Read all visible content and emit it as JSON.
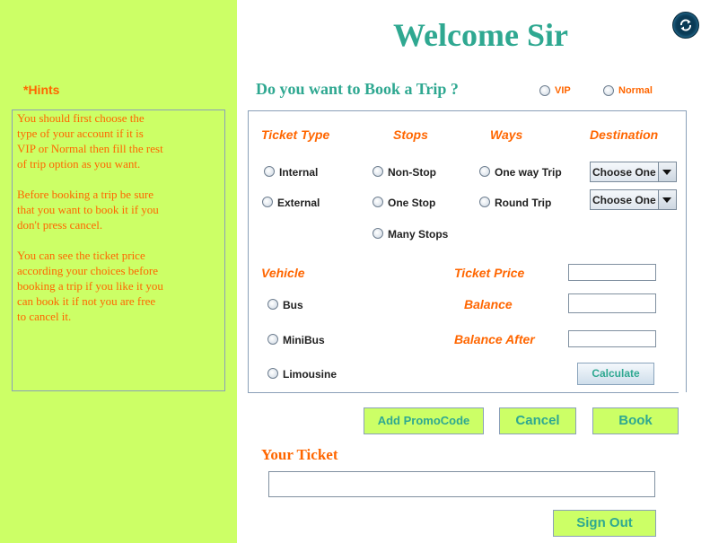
{
  "hints": {
    "title": "*Hints",
    "paragraphs": [
      "You should first choose the\ntype of your account if it is\nVIP or Normal then fill the rest\nof trip option as you want.",
      "Before booking a trip be sure\nthat you want to book it if you\ndon't press cancel.",
      "You can see the ticket price\naccording your choices before\nbooking a trip if you like it you\ncan book it if not you are free\nto cancel it."
    ]
  },
  "header": {
    "welcome": "Welcome Sir",
    "refresh_icon": "refresh-icon"
  },
  "account": {
    "question": "Do you want to Book a Trip ?",
    "vip_label": "VIP",
    "normal_label": "Normal"
  },
  "trip": {
    "ticket_type_header": "Ticket Type",
    "ticket_types": [
      "Internal",
      "External"
    ],
    "stops_header": "Stops",
    "stops": [
      "Non-Stop",
      "One Stop",
      "Many Stops"
    ],
    "ways_header": "Ways",
    "ways": [
      "One way Trip",
      "Round Trip"
    ],
    "destination_header": "Destination",
    "destination_from": "Choose One",
    "destination_to": "Choose One",
    "vehicle_header": "Vehicle",
    "vehicles": [
      "Bus",
      "MiniBus",
      "Limousine"
    ],
    "ticket_price_label": "Ticket Price",
    "ticket_price_value": "",
    "balance_label": "Balance",
    "balance_value": "",
    "balance_after_label": "Balance After",
    "balance_after_value": "",
    "calculate_label": "Calculate"
  },
  "actions": {
    "promo_label": "Add PromoCode",
    "cancel_label": "Cancel",
    "book_label": "Book"
  },
  "ticket": {
    "title": "Your Ticket",
    "value": ""
  },
  "signout_label": "Sign Out",
  "colors": {
    "left_panel": "#ccff66",
    "teal_text": "#2fa891",
    "orange_text": "#ff6600"
  }
}
